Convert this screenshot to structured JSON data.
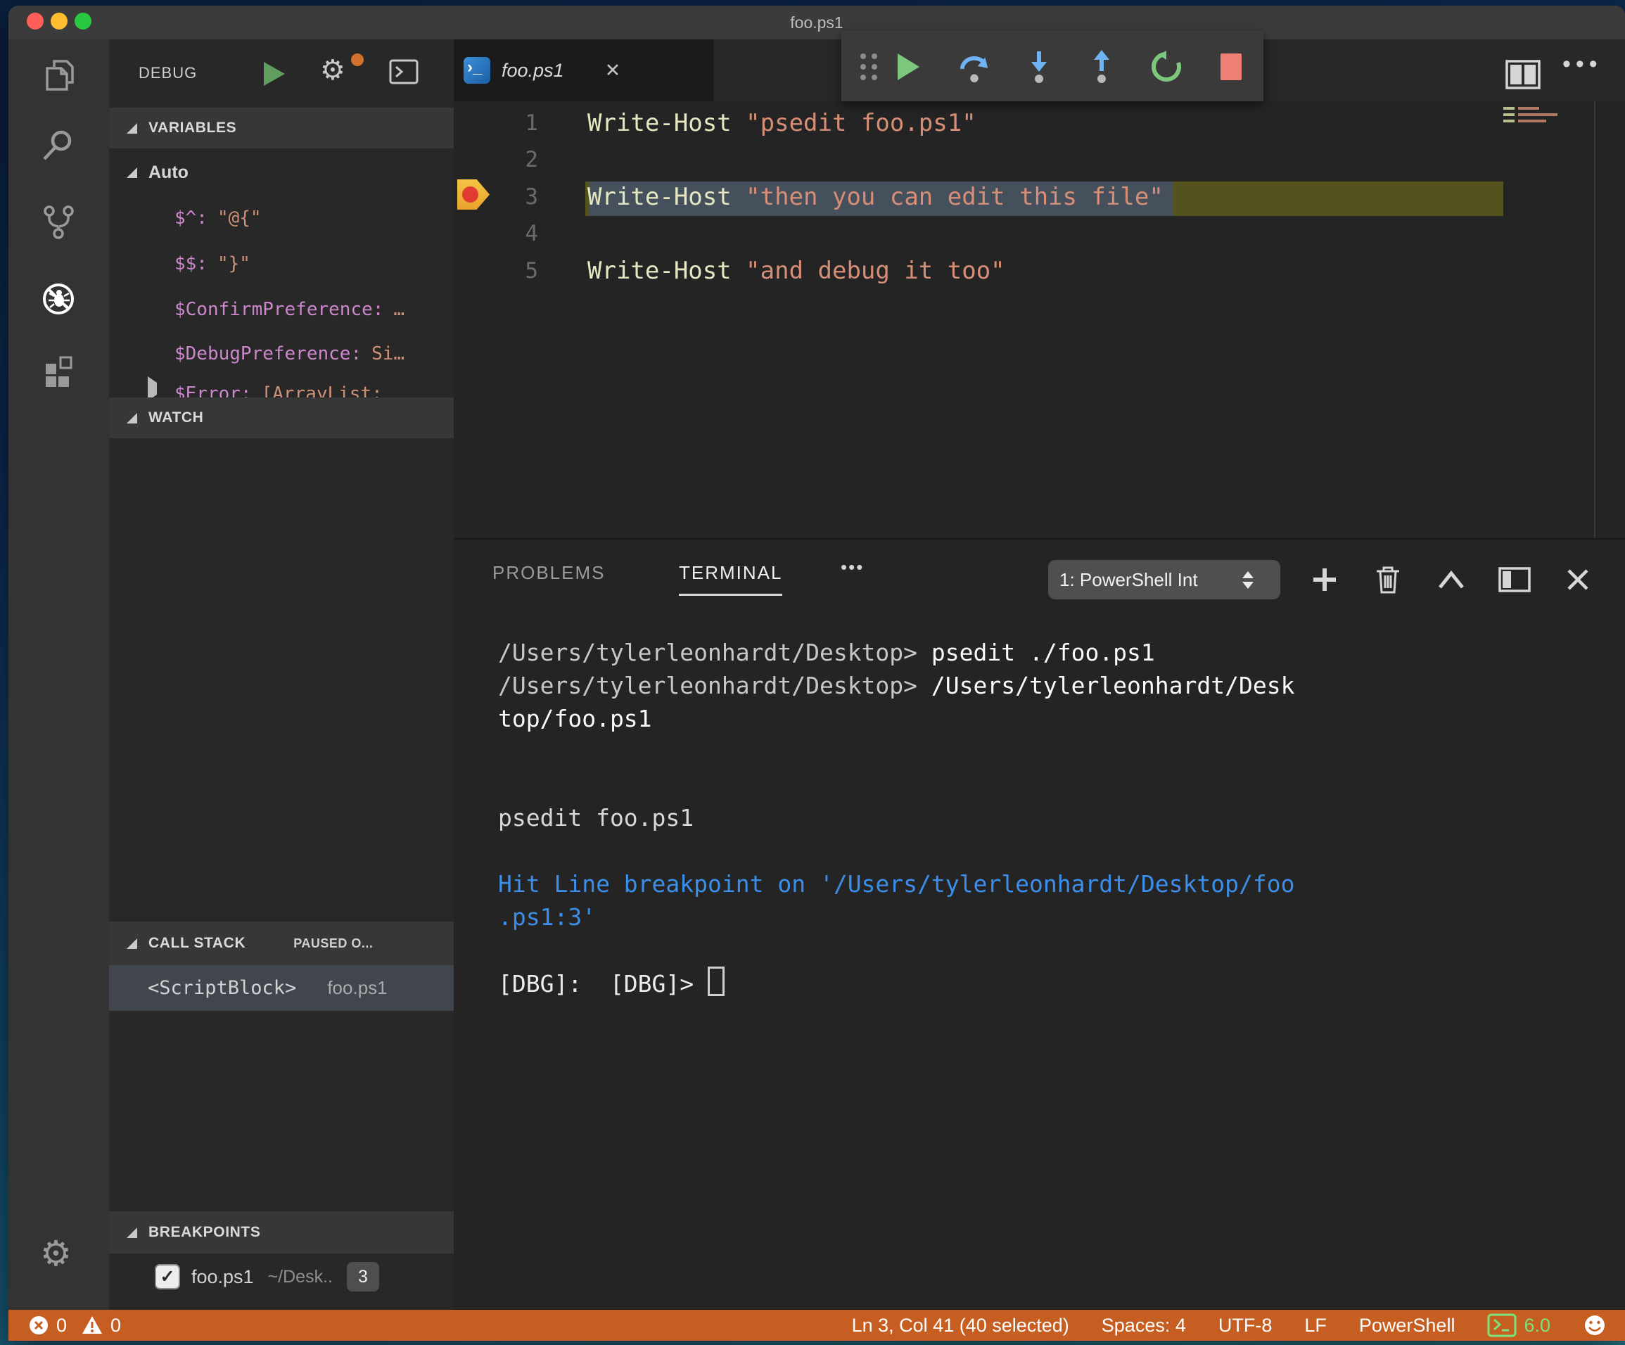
{
  "window": {
    "title": "foo.ps1"
  },
  "colors": {
    "statusbar_debug_orange": "#C65D21",
    "terminal_info_blue": "#3B8EEA",
    "string_orange": "#D68F76",
    "command_yellow": "#E4E7C0",
    "variable_pink": "#CC87CC",
    "continue_green": "#7DC87D",
    "stop_red": "#EF8076",
    "step_blue": "#6FB3F2",
    "breakpoint_marker_yellow": "#F0B73D",
    "breakpoint_marker_red": "#E23B32",
    "ps_version_green": "#7CE27C"
  },
  "icons": {
    "tab_close": "✕",
    "overflow_dots": "•••",
    "editor_overflow_dots": "•••",
    "checkbox_check": "✓"
  },
  "sidebar": {
    "title": "DEBUG",
    "variables": {
      "header": "VARIABLES",
      "scope": "Auto",
      "items": [
        {
          "name": "$^:",
          "value": "\"@{\""
        },
        {
          "name": "$$:",
          "value": "\"}\""
        },
        {
          "name": "$ConfirmPreference:",
          "value": "…"
        },
        {
          "name": "$DebugPreference:",
          "value": "Si…"
        },
        {
          "name": "$Error:",
          "value": "[ArrayList:"
        }
      ]
    },
    "watch": {
      "header": "WATCH"
    },
    "call_stack": {
      "header": "CALL STACK",
      "state": "PAUSED O...",
      "frame": {
        "name": "<ScriptBlock>",
        "file": "foo.ps1"
      }
    },
    "breakpoints": {
      "header": "BREAKPOINTS",
      "items": [
        {
          "file": "foo.ps1",
          "path": "~/Desk..",
          "line": "3"
        }
      ]
    }
  },
  "editor": {
    "tab": {
      "label": "foo.ps1"
    },
    "lines": [
      {
        "num": "1",
        "cmd": "Write-Host ",
        "str": "\"psedit foo.ps1\""
      },
      {
        "num": "2",
        "cmd": "",
        "str": ""
      },
      {
        "num": "3",
        "cmd": "Write-Host ",
        "str": "\"then you can edit this file\""
      },
      {
        "num": "4",
        "cmd": "",
        "str": ""
      },
      {
        "num": "5",
        "cmd": "Write-Host ",
        "str": "\"and debug it too\""
      }
    ]
  },
  "panel": {
    "tab_problems": "PROBLEMS",
    "tab_terminal": "TERMINAL",
    "dropdown_value": "1: PowerShell Int"
  },
  "terminal": {
    "l1p": "/Users/tylerleonhardt/Desktop> ",
    "l1c": "psedit ./foo.ps1",
    "l2p": "/Users/tylerleonhardt/Desktop> ",
    "l2c": "/Users/tylerleonhardt/Desk",
    "l3": "top/foo.ps1",
    "l4": "psedit foo.ps1",
    "l5": "Hit Line breakpoint on '/Users/tylerleonhardt/Desktop/foo",
    "l6": ".ps1:3'",
    "l7": "[DBG]:  [DBG]> "
  },
  "status_bar": {
    "errors": "0",
    "warnings": "0",
    "cursor": "Ln 3, Col 41 (40 selected)",
    "indent": "Spaces: 4",
    "encoding": "UTF-8",
    "eol": "LF",
    "language": "PowerShell",
    "ps_version": "6.0"
  }
}
